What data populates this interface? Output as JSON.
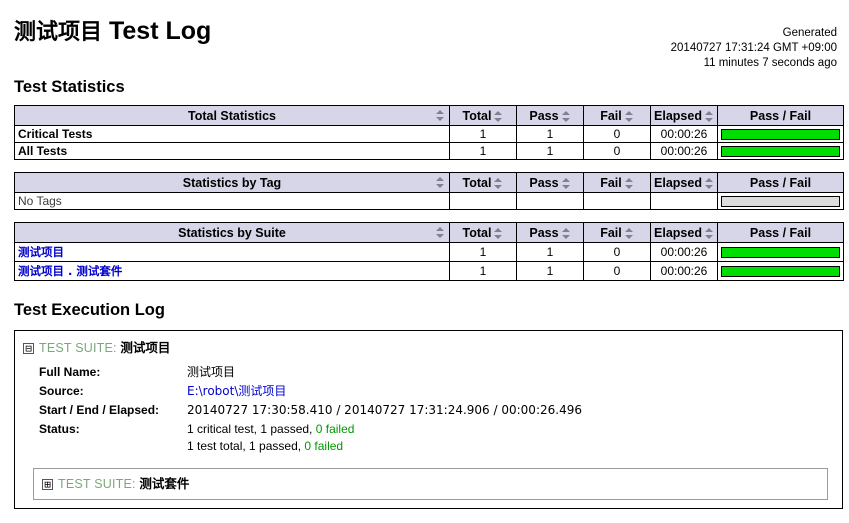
{
  "header": {
    "title_cn": "测试项目",
    "title_en": "Test Log",
    "generated_label": "Generated",
    "generated_time": "20140727 17:31:24 GMT +09:00",
    "generated_ago": "11 minutes 7 seconds ago"
  },
  "sections": {
    "statistics_heading": "Test Statistics",
    "execution_log_heading": "Test Execution Log"
  },
  "columns": {
    "total": "Total",
    "pass": "Pass",
    "fail": "Fail",
    "elapsed": "Elapsed",
    "passfail": "Pass / Fail",
    "sort_icon": "sort-arrows-icon"
  },
  "tables": [
    {
      "id": "total-statistics",
      "title": "Total Statistics",
      "rows": [
        {
          "name": "Critical Tests",
          "name_style": "bold",
          "total": "1",
          "pass": "1",
          "fail": "0",
          "elapsed": "00:00:26",
          "pass_pct": 100,
          "fail_pct": 0,
          "empty_bar": false
        },
        {
          "name": "All Tests",
          "name_style": "bold",
          "total": "1",
          "pass": "1",
          "fail": "0",
          "elapsed": "00:00:26",
          "pass_pct": 100,
          "fail_pct": 0,
          "empty_bar": false
        }
      ]
    },
    {
      "id": "statistics-by-tag",
      "title": "Statistics by Tag",
      "rows": [
        {
          "name": "No Tags",
          "name_style": "plain",
          "total": "",
          "pass": "",
          "fail": "",
          "elapsed": "",
          "pass_pct": 0,
          "fail_pct": 0,
          "empty_bar": true
        }
      ]
    },
    {
      "id": "statistics-by-suite",
      "title": "Statistics by Suite",
      "rows": [
        {
          "name": "测试项目",
          "name_style": "link",
          "total": "1",
          "pass": "1",
          "fail": "0",
          "elapsed": "00:00:26",
          "pass_pct": 100,
          "fail_pct": 0,
          "empty_bar": false
        },
        {
          "name": "测试项目 . 测试套件",
          "name_style": "link",
          "total": "1",
          "pass": "1",
          "fail": "0",
          "elapsed": "00:00:26",
          "pass_pct": 100,
          "fail_pct": 0,
          "empty_bar": false
        }
      ]
    }
  ],
  "execution_log": {
    "suite": {
      "toggle_icon": "collapse-minus-icon",
      "toggle_glyph": "−",
      "kind": "TEST SUITE:",
      "name": "测试项目",
      "meta": [
        {
          "key": "Full Name:",
          "value": "测试项目",
          "type": "text"
        },
        {
          "key": "Source:",
          "value": "E:\\robot\\测试项目",
          "type": "link"
        },
        {
          "key": "Start / End / Elapsed:",
          "value": "20140727 17:30:58.410 / 20140727 17:31:24.906 / 00:00:26.496",
          "type": "text"
        }
      ],
      "status_key": "Status:",
      "status_lines": [
        {
          "prefix": "1 critical test, 1 passed, ",
          "ok_text": "0 failed"
        },
        {
          "prefix": "1 test total, 1 passed, ",
          "ok_text": "0 failed"
        }
      ],
      "child_suite": {
        "toggle_icon": "expand-plus-icon",
        "toggle_glyph": "+",
        "kind": "TEST SUITE:",
        "name": "测试套件"
      }
    }
  },
  "colors": {
    "header_bg": "#d6d6e8",
    "pass_green": "#00dd00",
    "fail_red": "#ff3333",
    "empty_bar": "#dddddd",
    "link_blue": "#0000cc",
    "suite_label_green": "#7aa87a",
    "status_ok_green": "#009900"
  }
}
